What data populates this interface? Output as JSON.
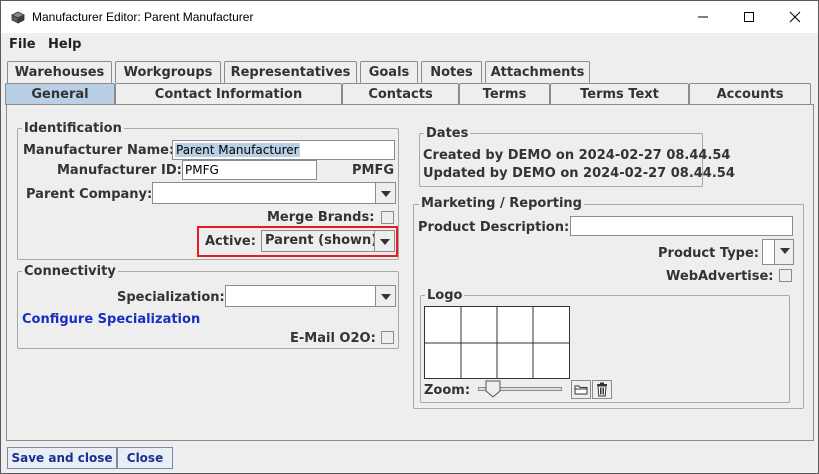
{
  "window": {
    "title": "Manufacturer Editor: Parent Manufacturer"
  },
  "menu": {
    "file": "File",
    "help": "Help"
  },
  "tabs": {
    "row1": [
      "Warehouses",
      "Workgroups",
      "Representatives",
      "Goals",
      "Notes",
      "Attachments"
    ],
    "row2": [
      "General",
      "Contact Information",
      "Contacts",
      "Terms",
      "Terms Text",
      "Accounts"
    ],
    "selected": "General"
  },
  "identification": {
    "legend": "Identification",
    "name_label": "Manufacturer Name:",
    "name_value": "Parent Manufacturer",
    "id_label": "Manufacturer ID:",
    "id_value": "PMFG",
    "id_code": "PMFG",
    "parent_label": "Parent Company:",
    "parent_value": "",
    "merge_label": "Merge Brands:",
    "active_label": "Active:",
    "active_value": "Parent (shown)"
  },
  "connectivity": {
    "legend": "Connectivity",
    "spec_label": "Specialization:",
    "spec_value": "",
    "configure_link": "Configure Specialization",
    "email_label": "E-Mail O2O:"
  },
  "dates": {
    "legend": "Dates",
    "created_prefix": "Created by",
    "created_user": "DEMO",
    "created_on": "on",
    "created_date": "2024-02-27 08.44.54",
    "updated_prefix": "Updated by",
    "updated_user": "DEMO",
    "updated_on": "on",
    "updated_date": "2024-02-27 08.44.54"
  },
  "marketing": {
    "legend": "Marketing / Reporting",
    "desc_label": "Product Description:",
    "desc_value": "",
    "type_label": "Product Type:",
    "webadv_label": "WebAdvertise:",
    "logo_legend": "Logo",
    "zoom_label": "Zoom:",
    "zoom_level": 0.1
  },
  "footer": {
    "save_close": "Save and close",
    "close": "Close"
  },
  "colors": {
    "highlight": "#e31c25",
    "selected_tab": "#b8cfe5",
    "link": "#1a2fbf"
  }
}
